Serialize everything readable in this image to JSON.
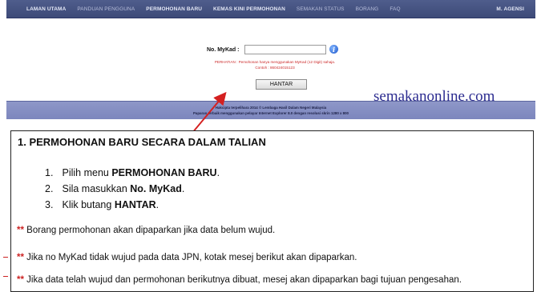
{
  "nav": {
    "items": [
      {
        "label": "LAMAN UTAMA",
        "style": "bold"
      },
      {
        "label": "PANDUAN PENGGUNA",
        "style": "dim"
      },
      {
        "label": "PERMOHONAN BARU",
        "style": "bold"
      },
      {
        "label": "KEMAS KINI PERMOHONAN",
        "style": "bold"
      },
      {
        "label": "SEMAKAN STATUS",
        "style": "dim"
      },
      {
        "label": "BORANG",
        "style": "dim"
      },
      {
        "label": "FAQ",
        "style": "dim"
      }
    ],
    "right_label": "M. AGENSI"
  },
  "form": {
    "mykad_label": "No. MyKad :",
    "mykad_value": "",
    "info_icon": "info-icon",
    "warning_line1": "PERHATIAN : Pemohonan hanya menggunakan MyKad (12 Digit) sahaja.",
    "warning_line2": "Contoh : 860424015123",
    "submit_label": "HANTAR"
  },
  "footer": {
    "line1": "Hakcipta terpelihara 2014 © Lembaga Hasil Dalam Negeri Malaysia",
    "line2": "Paparan terbaik menggunakan pelayar Internet Explorer 8.0 dengan resolusi skrin 1280 x 800"
  },
  "watermark": "semakanonline.com",
  "instructions": {
    "title": "1. PERMOHONAN BARU SECARA DALAM TALIAN",
    "steps": [
      {
        "num": "1.",
        "text": "Pilih menu ",
        "bold": "PERMOHONAN BARU",
        "tail": "."
      },
      {
        "num": "2.",
        "text": "Sila masukkan ",
        "bold": "No. MyKad",
        "tail": "."
      },
      {
        "num": "3.",
        "text": "Klik butang ",
        "bold": "HANTAR",
        "tail": "."
      }
    ],
    "notes": [
      {
        "marker": "**",
        "text": " Borang permohonan akan dipaparkan jika data belum wujud."
      },
      {
        "marker": "**",
        "text": " Jika no MyKad tidak wujud pada data JPN, kotak mesej berikut akan dipaparkan."
      },
      {
        "marker": "**",
        "text": " Jika data telah wujud dan permohonan berikutnya dibuat, mesej akan dipaparkan bagi tujuan pengesahan."
      }
    ]
  },
  "colors": {
    "nav_bg": "#445183",
    "footer_bg": "#848ec2",
    "warning_text": "#cc2a2a",
    "arrow": "#d42020",
    "watermark": "#2c2c90"
  }
}
